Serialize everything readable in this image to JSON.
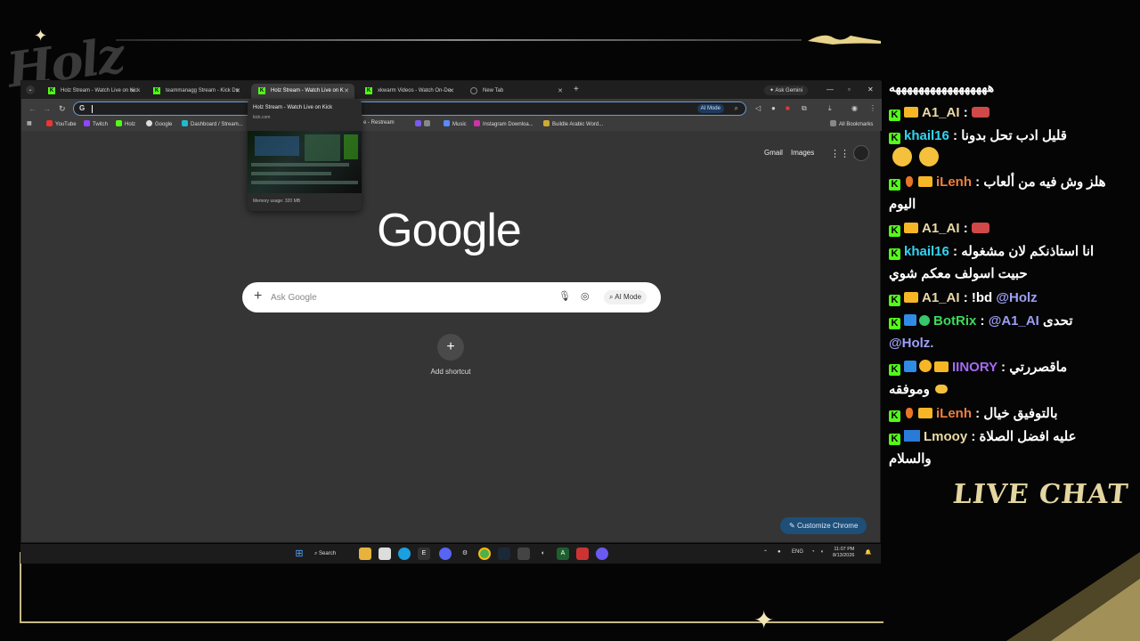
{
  "browser": {
    "tabs": [
      {
        "title": "Holz Stream - Watch Live on Kick",
        "icon": "kick-icon"
      },
      {
        "title": "teammanagg Stream - Kick Dc",
        "icon": "kick-icon"
      },
      {
        "title": "Holz Stream - Watch Live on K",
        "icon": "kick-icon",
        "active": true
      },
      {
        "title": "xkwarm Videos - Watch On-De",
        "icon": "kick-icon"
      },
      {
        "title": "New Tab",
        "icon": "chrome-icon"
      }
    ],
    "ask_gemini": "Ask Gemini",
    "omnibox": {
      "ai_mode": "AI Mode"
    },
    "bookmarks": [
      "YouTube",
      "Twitch",
      "Holz",
      "Google",
      "Dashboard / Stream...",
      "e - Restream",
      "Music",
      "Instagram Downloa...",
      "Buildle Arabic Word..."
    ],
    "all_bookmarks": "All Bookmarks",
    "tab_preview": {
      "title": "Holz Stream - Watch Live on Kick",
      "domain": "kick.com",
      "memory": "Memory usage: 320 MB"
    },
    "ntp": {
      "gmail": "Gmail",
      "images": "Images",
      "logo": "Google",
      "search_placeholder": "Ask Google",
      "ai_mode": "AI Mode",
      "add_shortcut": "Add shortcut",
      "customize": "Customize Chrome"
    }
  },
  "taskbar": {
    "search": "Search",
    "tray_lang": "ENG",
    "time": "11:07 PM",
    "date": "8/13/2026"
  },
  "chat": {
    "top_line": "هههههههههههههههههه",
    "messages": [
      {
        "user": "A1_AI",
        "text": ""
      },
      {
        "user": "khail16",
        "text": "قليل ادب تحل بدونا"
      },
      {
        "user": "iLenh",
        "text": "هلز وش فيه من ألعاب اليوم"
      },
      {
        "user": "A1_AI",
        "text": ""
      },
      {
        "user": "khail16",
        "text": "انا استاذنكم لان مشغوله حبيت اسولف معكم شوي"
      },
      {
        "user": "A1_AI",
        "text": "!bd",
        "mention": "@Holz"
      },
      {
        "user": "BotRix",
        "mention": "@A1_AI",
        "text": "تحدى",
        "mention2": "@Holz."
      },
      {
        "user": "IINORY",
        "text": "ماقصررتي",
        "text2": "وموفقه"
      },
      {
        "user": "iLenh",
        "text": "بالتوفيق خيال"
      },
      {
        "user": "Lmooy",
        "text": "عليه افضل الصلاة",
        "text2": "والسلام"
      }
    ],
    "live_chat": "LIVE CHAT"
  },
  "overlay": {
    "logo": "Holz"
  },
  "colors": {
    "kick_green": "#53fc18",
    "accent_gold": "#e3d6a0"
  }
}
